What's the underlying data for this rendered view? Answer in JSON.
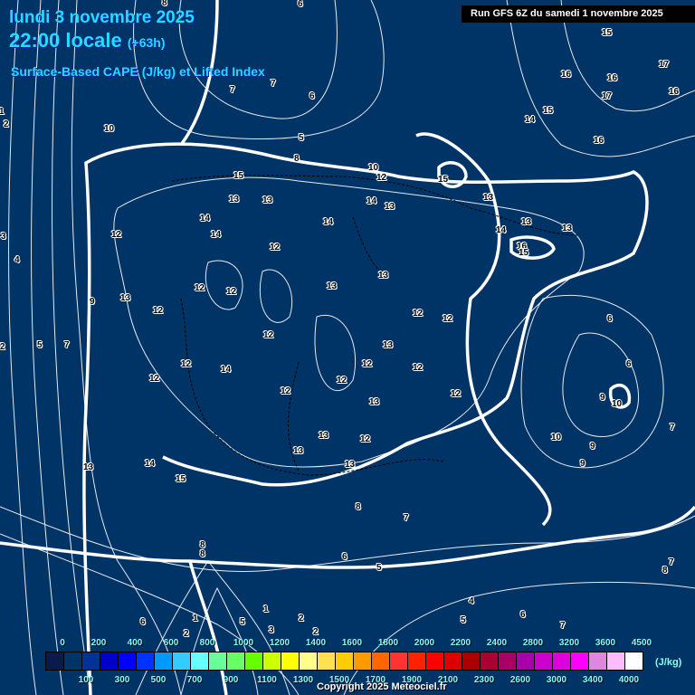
{
  "header": {
    "date": "lundi 3 novembre 2025",
    "time": "22:00 locale",
    "lead": "(+63h)",
    "product": "Surface-Based CAPE (J/kg) et Lifted Index",
    "run": "Run GFS 6Z du samedi 1 novembre 2025"
  },
  "contour_labels": [
    "8",
    "6",
    "15",
    "17",
    "16",
    "16",
    "16",
    "17",
    "7",
    "7",
    "6",
    "15",
    "14",
    "16",
    "10",
    "2",
    "1",
    "5",
    "8",
    "10",
    "12",
    "15",
    "15",
    "13",
    "13",
    "14",
    "13",
    "13",
    "14",
    "14",
    "13",
    "14",
    "13",
    "12",
    "14",
    "12",
    "16",
    "15",
    "3",
    "4",
    "13",
    "13",
    "12",
    "12",
    "13",
    "9",
    "12",
    "12",
    "12",
    "6",
    "12",
    "5",
    "7",
    "2",
    "13",
    "12",
    "12",
    "12",
    "6",
    "12",
    "14",
    "12",
    "12",
    "12",
    "9",
    "10",
    "13",
    "7",
    "13",
    "12",
    "10",
    "9",
    "13",
    "13",
    "9",
    "14",
    "13",
    "15",
    "8",
    "7",
    "8",
    "8",
    "6",
    "5",
    "7",
    "8",
    "4",
    "6",
    "5",
    "1",
    "2",
    "1",
    "5",
    "3",
    "6",
    "2",
    "2",
    "7"
  ],
  "legend": {
    "unit": "(J/kg)",
    "colors": [
      "#0a1a4a",
      "#003366",
      "#003399",
      "#0000cc",
      "#0000ff",
      "#0033ff",
      "#0099ff",
      "#33ccff",
      "#66ffff",
      "#66ff99",
      "#66ff66",
      "#66ff00",
      "#ccff00",
      "#ffff00",
      "#ffff88",
      "#ffe050",
      "#ffcc00",
      "#ff9900",
      "#ff6600",
      "#ff3333",
      "#ff2200",
      "#ff0000",
      "#dd0000",
      "#aa0000",
      "#aa0033",
      "#aa0066",
      "#aa00aa",
      "#cc00cc",
      "#dd00dd",
      "#ff00ff",
      "#dd88dd",
      "#ffbbff",
      "#ffffff"
    ],
    "top_ticks": [
      "0",
      "200",
      "400",
      "600",
      "800",
      "1000",
      "1200",
      "1400",
      "1600",
      "1800",
      "2000",
      "2200",
      "2400",
      "2800",
      "3200",
      "3600",
      "4500"
    ],
    "bottom_ticks": [
      "100",
      "300",
      "500",
      "700",
      "900",
      "1100",
      "1300",
      "1500",
      "1700",
      "1900",
      "2100",
      "2300",
      "2600",
      "3000",
      "3400",
      "4000"
    ]
  },
  "copyright": "Copyright 2025 Meteociel.fr"
}
